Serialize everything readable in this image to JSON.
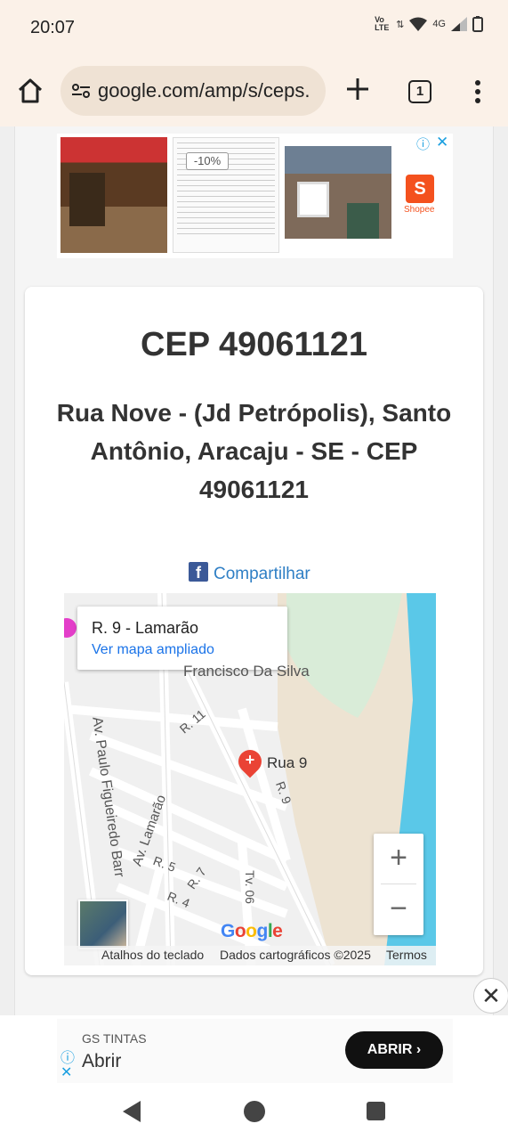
{
  "status_bar": {
    "time": "20:07",
    "network": "4G",
    "volte": "Vo LTE"
  },
  "toolbar": {
    "url": "google.com/amp/s/ceps.",
    "tab_count": "1"
  },
  "top_ad": {
    "badge": "-10%",
    "brand": "Shopee"
  },
  "card": {
    "cep_title": "CEP 49061121",
    "address": "Rua Nove - (Jd Petrópolis), Santo Antônio, Aracaju - SE - CEP 49061121",
    "share_label": "Compartilhar"
  },
  "map": {
    "popup_title": "R. 9 - Lamarão",
    "popup_link": "Ver mapa ampliado",
    "marker_label": "Rua 9",
    "labels": {
      "francisco": "Francisco Da Silva",
      "r11": "R. 11",
      "r9": "R. 9",
      "av_paulo": "Av. Paulo Figueiredo Barr",
      "av_lamarao": "Av. Lamarão",
      "r5": "R. 5",
      "r7": "R. 7",
      "r4": "R. 4",
      "tv06": "Tv. 06"
    },
    "zoom_in": "+",
    "zoom_out": "−",
    "google": "Google",
    "footer": {
      "shortcuts": "Atalhos do teclado",
      "data": "Dados cartográficos ©2025",
      "terms": "Termos"
    }
  },
  "bottom_ad": {
    "brand": "GS TINTAS",
    "title": "Abrir",
    "button": "ABRIR"
  },
  "colors": {
    "accent_blue": "#1a73e8",
    "facebook": "#3b5998",
    "water": "#5ac8e8",
    "pin": "#ea4335"
  }
}
